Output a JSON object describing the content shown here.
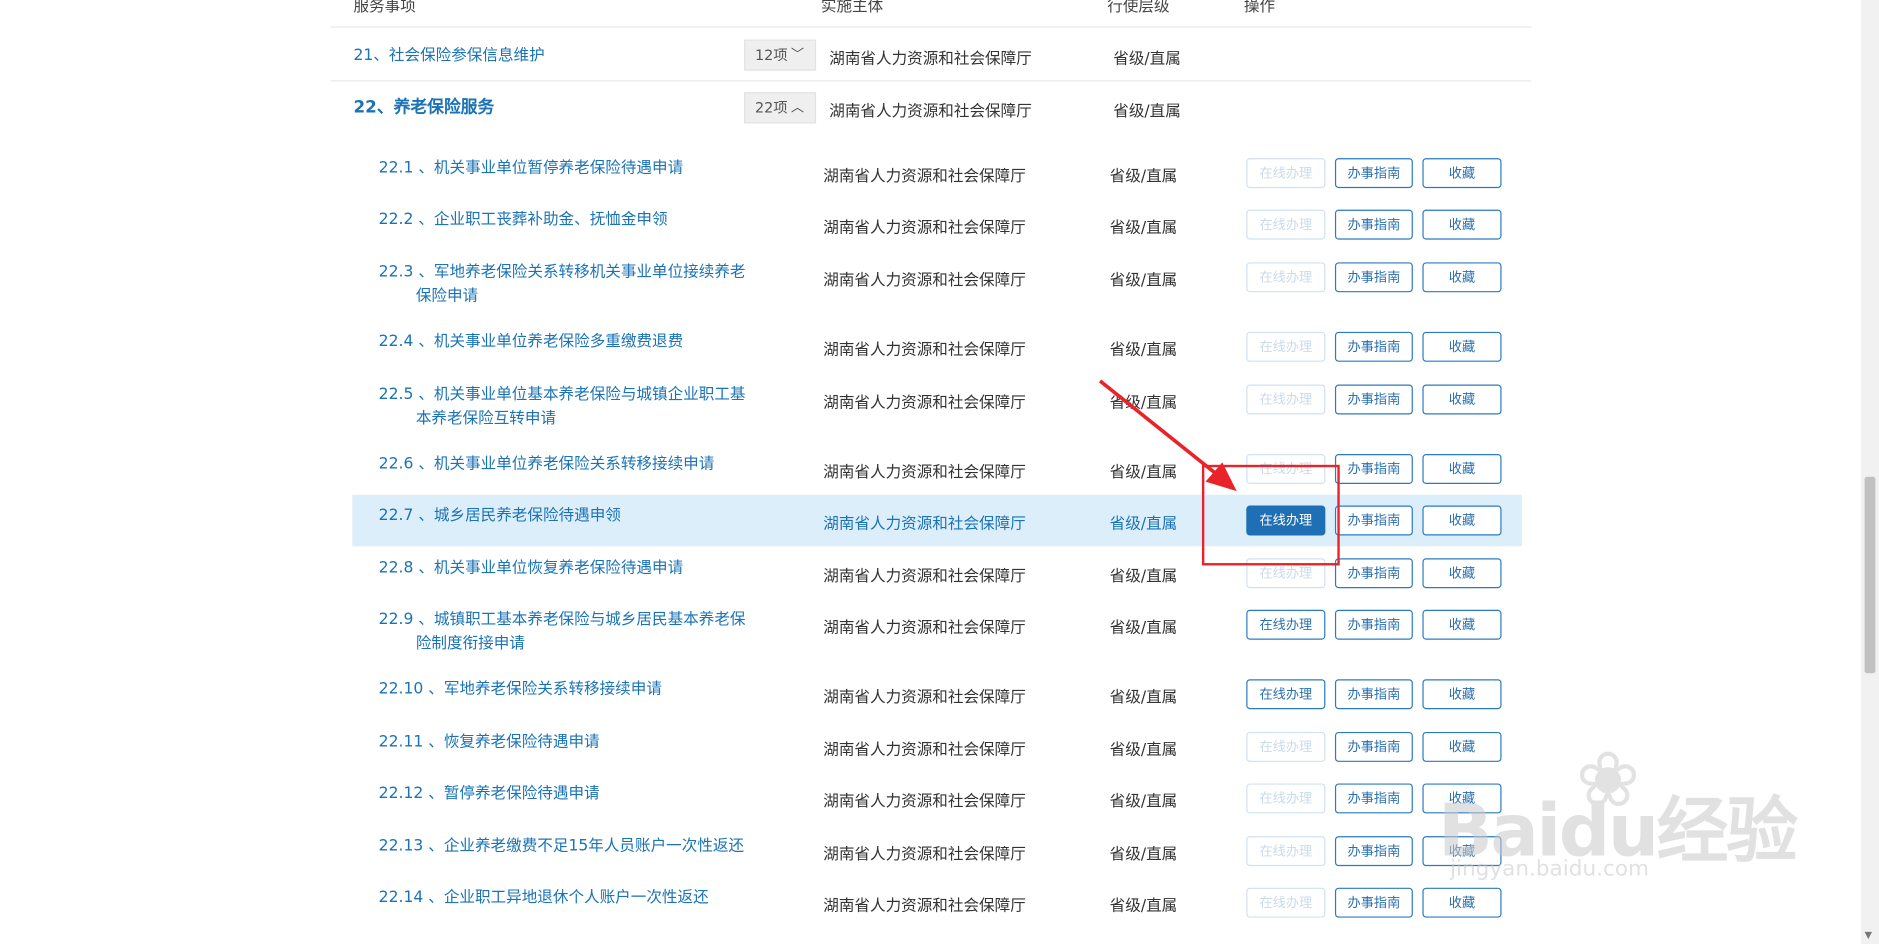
{
  "header": {
    "col_item": "服务事项",
    "col_org": "实施主体",
    "col_level": "行使层级",
    "col_action": "操作"
  },
  "categories": [
    {
      "title": "21、社会保险参保信息维护",
      "count": "12项",
      "org": "湖南省人力资源和社会保障厅",
      "level": "省级/直属",
      "expanded": false
    },
    {
      "title": "22、养老保险服务",
      "count": "22项",
      "org": "湖南省人力资源和社会保障厅",
      "level": "省级/直属",
      "expanded": true
    }
  ],
  "buttons": {
    "online": "在线办理",
    "guide": "办事指南",
    "favorite": "收藏"
  },
  "items": [
    {
      "num": "22.1",
      "title": "、机关事业单位暂停养老保险待遇申请",
      "title2": "",
      "org": "湖南省人力资源和社会保障厅",
      "level": "省级/直属",
      "online_state": "disabled"
    },
    {
      "num": "22.2",
      "title": "、企业职工丧葬补助金、抚恤金申领",
      "title2": "",
      "org": "湖南省人力资源和社会保障厅",
      "level": "省级/直属",
      "online_state": "disabled"
    },
    {
      "num": "22.3",
      "title": "、军地养老保险关系转移机关事业单位接续养老",
      "title2": "保险申请",
      "org": "湖南省人力资源和社会保障厅",
      "level": "省级/直属",
      "online_state": "disabled"
    },
    {
      "num": "22.4",
      "title": "、机关事业单位养老保险多重缴费退费",
      "title2": "",
      "org": "湖南省人力资源和社会保障厅",
      "level": "省级/直属",
      "online_state": "disabled"
    },
    {
      "num": "22.5",
      "title": "、机关事业单位基本养老保险与城镇企业职工基",
      "title2": "本养老保险互转申请",
      "org": "湖南省人力资源和社会保障厅",
      "level": "省级/直属",
      "online_state": "disabled"
    },
    {
      "num": "22.6",
      "title": "、机关事业单位养老保险关系转移接续申请",
      "title2": "",
      "org": "湖南省人力资源和社会保障厅",
      "level": "省级/直属",
      "online_state": "disabled"
    },
    {
      "num": "22.7",
      "title": "、城乡居民养老保险待遇申领",
      "title2": "",
      "org": "湖南省人力资源和社会保障厅",
      "level": "省级/直属",
      "online_state": "primary"
    },
    {
      "num": "22.8",
      "title": "、机关事业单位恢复养老保险待遇申请",
      "title2": "",
      "org": "湖南省人力资源和社会保障厅",
      "level": "省级/直属",
      "online_state": "disabled"
    },
    {
      "num": "22.9",
      "title": "、城镇职工基本养老保险与城乡居民基本养老保",
      "title2": "险制度衔接申请",
      "org": "湖南省人力资源和社会保障厅",
      "level": "省级/直属",
      "online_state": "enabled"
    },
    {
      "num": "22.10",
      "title": "、军地养老保险关系转移接续申请",
      "title2": "",
      "org": "湖南省人力资源和社会保障厅",
      "level": "省级/直属",
      "online_state": "enabled"
    },
    {
      "num": "22.11",
      "title": "、恢复养老保险待遇申请",
      "title2": "",
      "org": "湖南省人力资源和社会保障厅",
      "level": "省级/直属",
      "online_state": "disabled"
    },
    {
      "num": "22.12",
      "title": "、暂停养老保险待遇申请",
      "title2": "",
      "org": "湖南省人力资源和社会保障厅",
      "level": "省级/直属",
      "online_state": "disabled"
    },
    {
      "num": "22.13",
      "title": "、企业养老缴费不足15年人员账户一次性返还",
      "title2": "",
      "org": "湖南省人力资源和社会保障厅",
      "level": "省级/直属",
      "online_state": "disabled"
    },
    {
      "num": "22.14",
      "title": "、企业职工异地退休个人账户一次性返还",
      "title2": "",
      "org": "湖南省人力资源和社会保障厅",
      "level": "省级/直属",
      "online_state": "disabled"
    }
  ],
  "watermark": {
    "logo": "Baidu经验",
    "url": "jingyan.baidu.com"
  },
  "colors": {
    "link": "#1b73b5",
    "highlight_row": "#ddeefb",
    "primary_button": "#1f6fb4",
    "annotation": "#e8242a"
  }
}
